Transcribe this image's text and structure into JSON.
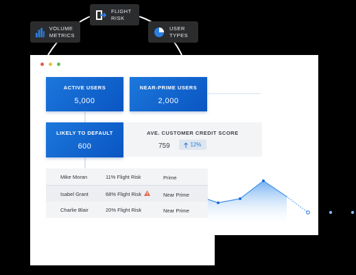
{
  "badges": {
    "volume": {
      "label": "VOLUME\nMETRICS",
      "icon": "bar-chart-icon",
      "color": "#2b7fe0"
    },
    "flight": {
      "label": "FLIGHT\nRISK",
      "icon": "exit-door-icon",
      "color": "#ffffff"
    },
    "users": {
      "label": "USER\nTYPES",
      "icon": "pie-chart-icon",
      "color": "#2b7fe0"
    }
  },
  "window": {
    "dots": [
      "#e85a4f",
      "#e6c340",
      "#5cbd54"
    ]
  },
  "cards": {
    "active": {
      "title": "ACTIVE USERS",
      "value": "5,000"
    },
    "near_prime": {
      "title": "NEAR-PRIME USERS",
      "value": "2,000"
    },
    "default": {
      "title": "LIKELY TO DEFAULT",
      "value": "600"
    }
  },
  "score": {
    "title": "AVE. CUSTOMER CREDIT SCORE",
    "value": "759",
    "change": "12%",
    "change_icon": "arrow-up-icon"
  },
  "table": {
    "rows": [
      {
        "name": "Mike Moran",
        "risk": "11% Flight Risk",
        "type": "Prime",
        "warning": false
      },
      {
        "name": "Isabel Grant",
        "risk": "68% Flight Risk",
        "type": "Near Prime",
        "warning": true
      },
      {
        "name": "Charlie Blair",
        "risk": "20% Flight Risk",
        "type": "Near Prime",
        "warning": false
      }
    ]
  },
  "colors": {
    "accent": "#1a6fd8",
    "line": "#3f8fe8"
  }
}
